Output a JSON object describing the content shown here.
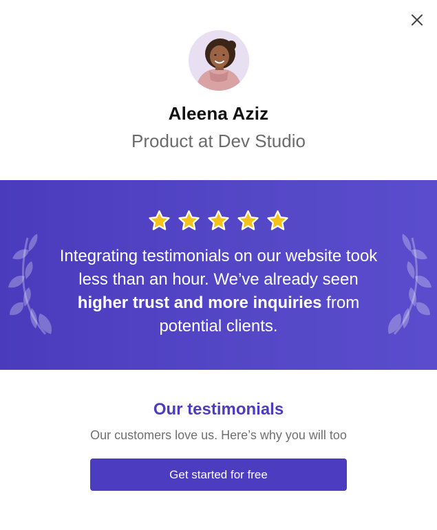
{
  "dialog": {
    "close_icon": "close-icon"
  },
  "profile": {
    "name": "Aleena Aziz",
    "role": "Product at Dev Studio"
  },
  "testimonial": {
    "rating": 5,
    "rating_max": 5,
    "quote_part1": "Integrating testimonials on our website took less than an hour. We’ve already seen ",
    "quote_bold": "higher trust and more inquiries",
    "quote_part2": " from potential clients."
  },
  "section": {
    "title": "Our testimonials",
    "subtitle": "Our customers love us. Here’s why you will too",
    "cta_label": "Get started for free"
  },
  "colors": {
    "accent": "#4b3cc0",
    "banner_start": "#4a3bbd",
    "banner_end": "#5a4ccc",
    "star": "#f5c21b"
  }
}
